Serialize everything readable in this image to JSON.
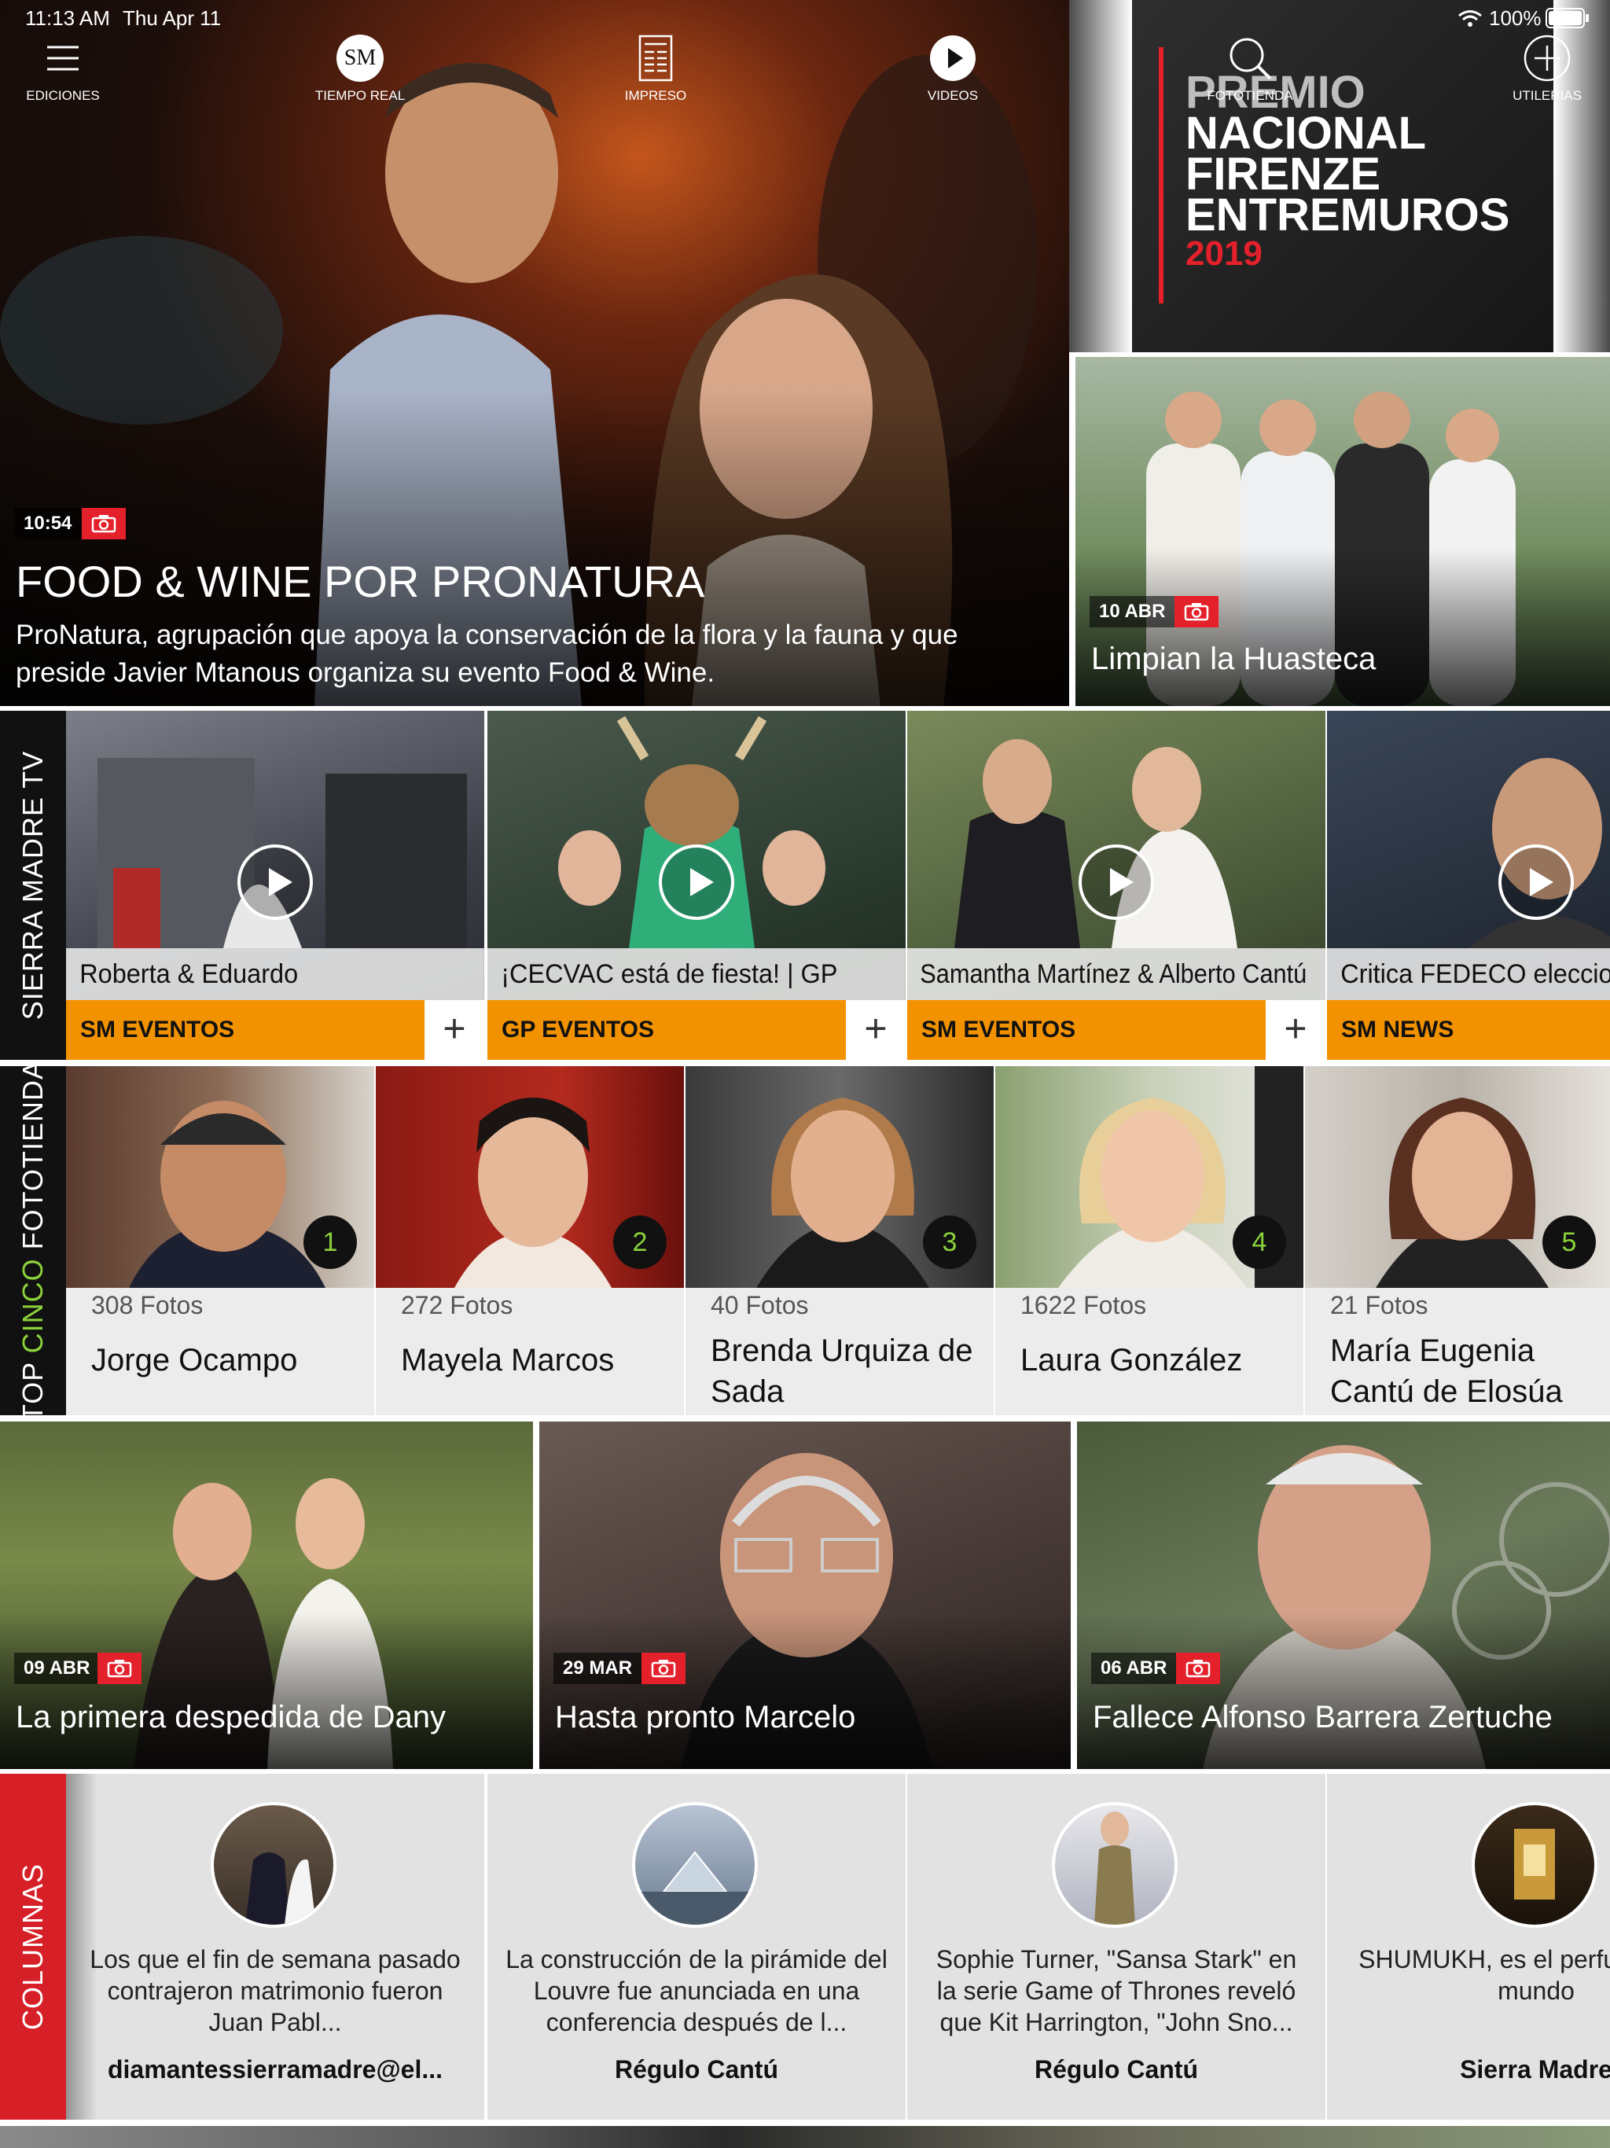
{
  "status_bar": {
    "time": "11:13 AM",
    "date": "Thu Apr 11",
    "battery": "100%"
  },
  "nav": {
    "ediciones": "EDICIONES",
    "tiempo_real": "TIEMPO REAL",
    "logo": "SM",
    "impreso": "IMPRESO",
    "videos": "VIDEOS",
    "fototienda": "FOTOTIENDA",
    "utilerias": "UTILERIAS"
  },
  "hero": {
    "time": "10:54",
    "title": "FOOD & WINE POR PRONATURA",
    "description": "ProNatura, agrupación que apoya la conservación de la flora y la fauna y que preside Javier Mtanous organiza su evento Food & Wine."
  },
  "ad": {
    "line1": "PREMIO",
    "line2": "NACIONAL",
    "line3": "FIRENZE",
    "line4": "ENTREMUROS",
    "year": "2019"
  },
  "side_story": {
    "date": "10 ABR",
    "title": "Limpian la Huasteca"
  },
  "sierra_tv": {
    "label": "SIERRA MADRE TV",
    "videos": [
      {
        "title": "Roberta & Eduardo",
        "category": "SM EVENTOS"
      },
      {
        "title": "¡CECVAC está de fiesta! | GP",
        "category": "GP EVENTOS"
      },
      {
        "title": "Samantha Martínez & Alberto Cantú",
        "category": "SM EVENTOS"
      },
      {
        "title": "Critica FEDECO elecciones de c",
        "category": "SM NEWS"
      }
    ]
  },
  "top_five": {
    "label_top": "TOP ",
    "label_cinco": "CINCO",
    "label_rest": " FOTOTIENDA",
    "items": [
      {
        "rank": "1",
        "count": "308 Fotos",
        "name": "Jorge Ocampo"
      },
      {
        "rank": "2",
        "count": "272 Fotos",
        "name": "Mayela Marcos"
      },
      {
        "rank": "3",
        "count": "40 Fotos",
        "name": "Brenda Urquiza de Sada"
      },
      {
        "rank": "4",
        "count": "1622 Fotos",
        "name": "Laura González"
      },
      {
        "rank": "5",
        "count": "21 Fotos",
        "name": "María Eugenia Cantú de Elosúa"
      }
    ]
  },
  "stories": [
    {
      "date": "09 ABR",
      "title": "La primera despedida de Dany"
    },
    {
      "date": "29 MAR",
      "title": "Hasta pronto Marcelo"
    },
    {
      "date": "06 ABR",
      "title": "Fallece Alfonso Barrera Zertuche"
    }
  ],
  "columnas": {
    "label": "COLUMNAS",
    "items": [
      {
        "text": "Los que el fin de semana pasado contrajeron matrimonio fueron Juan Pabl...",
        "author": "diamantessierramadre@el..."
      },
      {
        "text": "La construcción de la pirámide del Louvre fue anunciada en una conferencia después de l...",
        "author": "Régulo Cantú"
      },
      {
        "text": "Sophie Turner, \"Sansa Stark\" en la serie Game of Thrones reveló que Kit Harrington, \"John Sno...",
        "author": "Régulo Cantú"
      },
      {
        "text": "SHUMUKH, es el perfu caro del mundo",
        "author": "Sierra Madre"
      }
    ]
  },
  "colors": {
    "accent_red": "#e4202b",
    "accent_orange": "#f39200",
    "accent_green": "#8bd23a"
  }
}
